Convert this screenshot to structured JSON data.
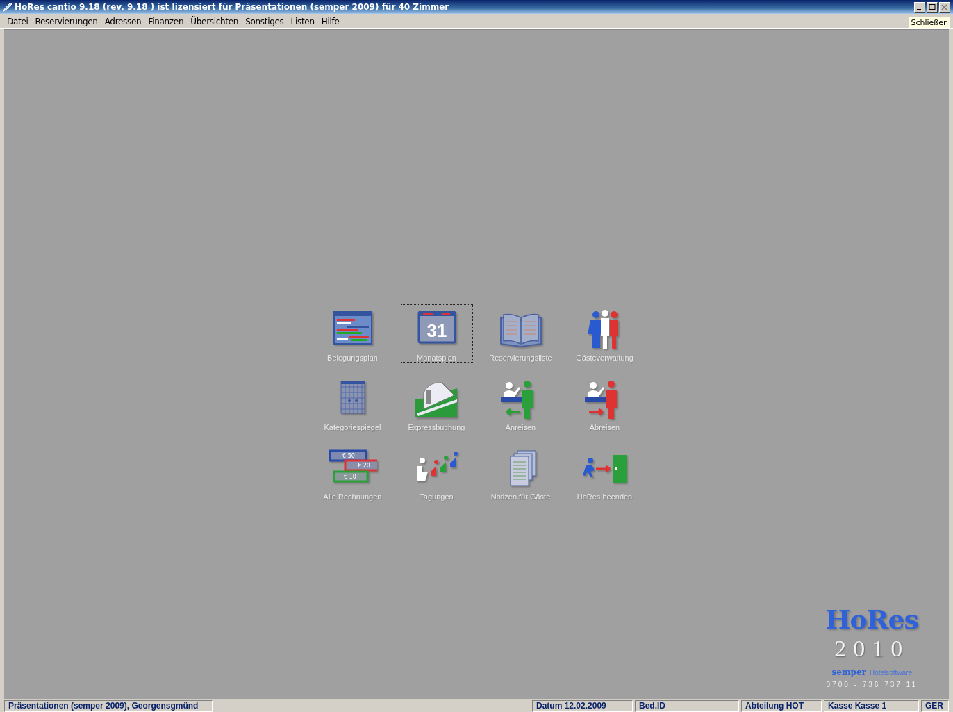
{
  "window": {
    "title": "HoRes cantio 9.18  (rev. 9.18 )  ist lizensiert für Präsentationen (semper 2009) für 40 Zimmer",
    "tooltip": "Schließen"
  },
  "menu": [
    "Datei",
    "Reservierungen",
    "Adressen",
    "Finanzen",
    "Übersichten",
    "Sonstiges",
    "Listen",
    "Hilfe"
  ],
  "tiles": [
    {
      "label": "Belegungsplan",
      "kind": "board",
      "selected": false
    },
    {
      "label": "Monatsplan",
      "kind": "calendar",
      "selected": true,
      "icon_text": "31"
    },
    {
      "label": "Reservierungsliste",
      "kind": "book",
      "selected": false
    },
    {
      "label": "Gästeverwaltung",
      "kind": "people",
      "selected": false
    },
    {
      "label": "Kategoriespiegel",
      "kind": "grid",
      "selected": false
    },
    {
      "label": "Expressbuchung",
      "kind": "train",
      "selected": false
    },
    {
      "label": "Anreisen",
      "kind": "arrive",
      "selected": false
    },
    {
      "label": "Abreisen",
      "kind": "depart",
      "selected": false
    },
    {
      "label": "Alle Rechnungen",
      "kind": "invoices",
      "selected": false,
      "icon_texts": [
        "€ 50",
        "€ 20",
        "€ 10"
      ]
    },
    {
      "label": "Tagungen",
      "kind": "meeting",
      "selected": false
    },
    {
      "label": "Notizen für Gäste",
      "kind": "notes",
      "selected": false
    },
    {
      "label": "HoRes beenden",
      "kind": "exit",
      "selected": false
    }
  ],
  "logo": {
    "name": "HoRes",
    "year": "2010",
    "company": "semper",
    "tagline": "Hotelsoftware",
    "phone": "0700 - 736 737 11"
  },
  "status_bar": {
    "location": "Präsentationen (semper 2009), Georgensgmünd",
    "fields": [
      "Datum 12.02.2009",
      "Bed.ID",
      "Abteilung HOT",
      "Kasse Kasse 1",
      "GER"
    ]
  }
}
